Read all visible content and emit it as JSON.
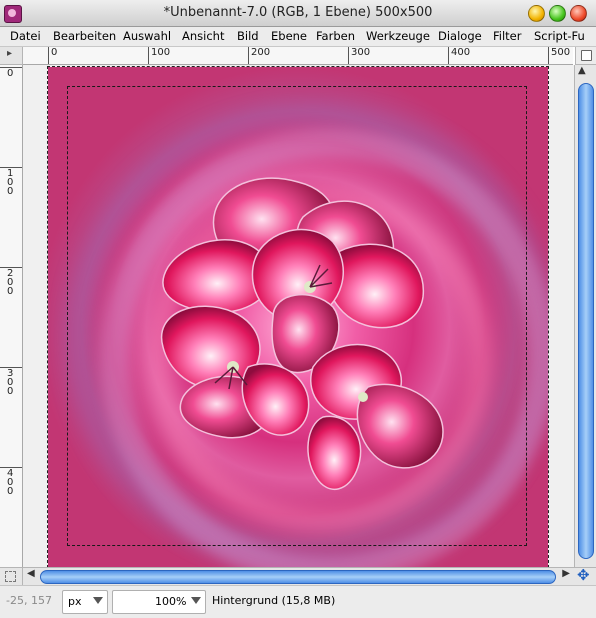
{
  "window": {
    "title": "*Unbenannt-7.0 (RGB, 1 Ebene) 500x500",
    "app_icon": "gimp-icon"
  },
  "menubar": {
    "items": [
      "Datei",
      "Bearbeiten",
      "Auswahl",
      "Ansicht",
      "Bild",
      "Ebene",
      "Farben",
      "Werkzeuge",
      "Dialoge",
      "Filter",
      "Script-Fu"
    ]
  },
  "rulers": {
    "horizontal_labels": [
      "0",
      "100",
      "200",
      "300",
      "400",
      "500"
    ],
    "vertical_labels": [
      "0",
      "100",
      "200",
      "300",
      "400"
    ]
  },
  "canvas": {
    "background_color": "#c3336f",
    "flower_colors": [
      "#e0175d",
      "#ff7fb8",
      "#8f0c3e",
      "#f4c0dc"
    ],
    "layer_name": "Hintergrund"
  },
  "statusbar": {
    "coords": "-25, 157",
    "unit": "px",
    "zoom": "100%",
    "layer_info": "Hintergrund (15,8 MB)"
  },
  "icons": {
    "quick_mask": "quick-mask-icon",
    "navigate": "navigate-icon",
    "menu_arrow": "menu-arrow-icon"
  }
}
